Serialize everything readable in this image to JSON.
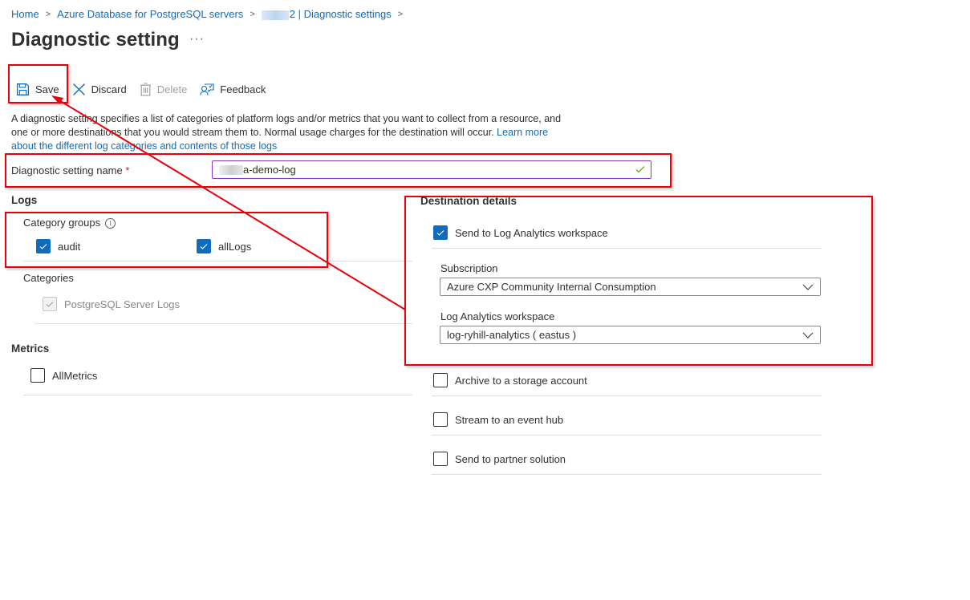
{
  "breadcrumb": {
    "items": [
      "Home",
      "Azure Database for PostgreSQL servers",
      "2 | Diagnostic settings"
    ]
  },
  "page": {
    "title": "Diagnostic setting",
    "more_label": "···"
  },
  "toolbar": {
    "save_label": "Save",
    "discard_label": "Discard",
    "delete_label": "Delete",
    "feedback_label": "Feedback"
  },
  "description": {
    "text": "A diagnostic setting specifies a list of categories of platform logs and/or metrics that you want to collect from a resource, and one or more destinations that you would stream them to. Normal usage charges for the destination will occur. ",
    "link_text": "Learn more about the different log categories and contents of those logs"
  },
  "name_field": {
    "label": "Diagnostic setting name",
    "required_mark": "*",
    "value": "a-demo-log"
  },
  "logs": {
    "heading": "Logs",
    "category_groups_label": "Category groups",
    "category_groups": [
      {
        "label": "audit",
        "checked": true
      },
      {
        "label": "allLogs",
        "checked": true
      }
    ],
    "categories_label": "Categories",
    "categories": [
      {
        "label": "PostgreSQL Server Logs",
        "checked": true,
        "disabled": true
      }
    ]
  },
  "metrics": {
    "heading": "Metrics",
    "items": [
      {
        "label": "AllMetrics",
        "checked": false
      }
    ]
  },
  "destination": {
    "heading": "Destination details",
    "log_analytics": {
      "label": "Send to Log Analytics workspace",
      "checked": true
    },
    "subscription_label": "Subscription",
    "subscription_value": "Azure CXP Community Internal Consumption",
    "workspace_label": "Log Analytics workspace",
    "workspace_value": "log-ryhill-analytics ( eastus )",
    "other_options": [
      {
        "label": "Archive to a storage account",
        "checked": false
      },
      {
        "label": "Stream to an event hub",
        "checked": false
      },
      {
        "label": "Send to partner solution",
        "checked": false
      }
    ]
  },
  "colors": {
    "accent": "#0f6cbd",
    "annotation": "#e8000b",
    "input_focus_border": "#8a3ab9",
    "valid_check": "#57a300"
  }
}
